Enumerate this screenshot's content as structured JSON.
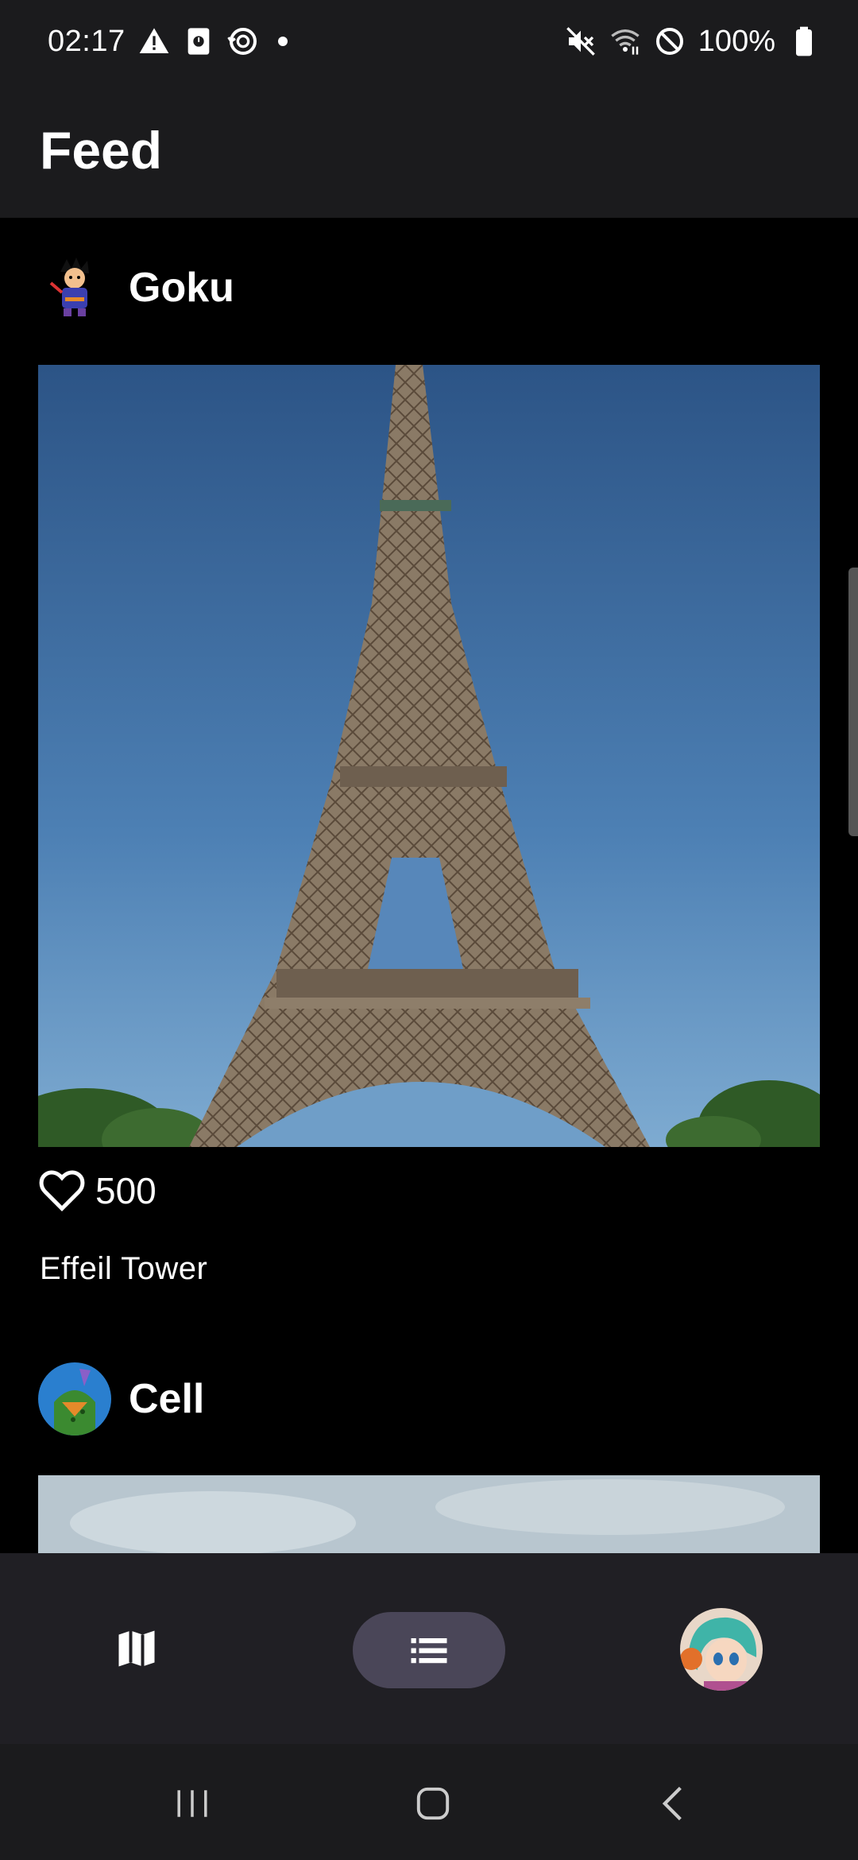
{
  "status_bar": {
    "time": "02:17",
    "battery_text": "100%",
    "icons": [
      "warning-icon",
      "storage-icon",
      "sync-icon",
      "notification-dot",
      "mute-icon",
      "wifi-icon",
      "do-not-disturb-icon",
      "battery-icon"
    ]
  },
  "app_bar": {
    "title": "Feed"
  },
  "posts": [
    {
      "username": "Goku",
      "image": "eiffel-tower-photo",
      "likes": "500",
      "caption": "Effeil Tower"
    },
    {
      "username": "Cell",
      "image": "sky-photo"
    }
  ],
  "bottom_nav": {
    "items": [
      "map-icon",
      "list-icon",
      "profile-avatar"
    ],
    "selected": "list-icon"
  },
  "system_nav": [
    "recent-apps-icon",
    "home-icon",
    "back-icon"
  ],
  "colors": {
    "bars": "#1b1b1d",
    "background": "#000000",
    "nav_background": "#201f24",
    "nav_selected": "#4a4658"
  }
}
